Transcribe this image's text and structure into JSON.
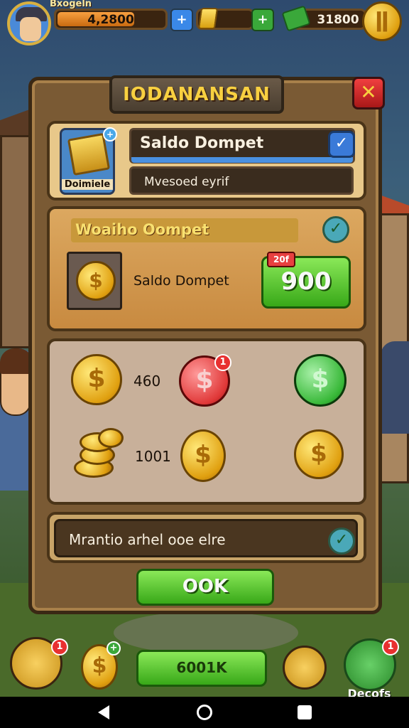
{
  "hud": {
    "player_name": "Bxogeln",
    "coins_value": "4,2800",
    "coins_fill": 0.7,
    "plus_icon": "+",
    "gem_icon": "gem-icon",
    "cash_plus": "+",
    "cash_value": "31800",
    "pause_icon": "pause-icon"
  },
  "dialog": {
    "title": "IODANANSAN",
    "close_glyph": "✕",
    "wallet": {
      "chest_label": "Doimiele",
      "chest_badge": "+",
      "title": "Saldo Dompet",
      "subtitle": "Mvesoed eyrif",
      "check_glyph": "✓"
    },
    "offer": {
      "title": "Woaiho Oompet",
      "check_glyph": "✓",
      "coin_glyph": "$",
      "label": "Saldo Dompet",
      "price_tag": "20f",
      "price": "900"
    },
    "coins": {
      "amount_1": "460",
      "amount_2": "1001",
      "badge_1": "1",
      "glyph": "$"
    },
    "message": {
      "text": "Mrantio arhel ooe elre",
      "check_glyph": "✓"
    },
    "ok_label": "OOK"
  },
  "bottom": {
    "left_badge": "1",
    "coin_badge": "+",
    "center_label": "6001K",
    "right_badge": "1",
    "right_label": "Decofs"
  },
  "colors": {
    "accent_gold": "#f8d040",
    "ok_green": "#38a818",
    "close_red": "#e03030",
    "check_blue": "#3a7ad8"
  }
}
